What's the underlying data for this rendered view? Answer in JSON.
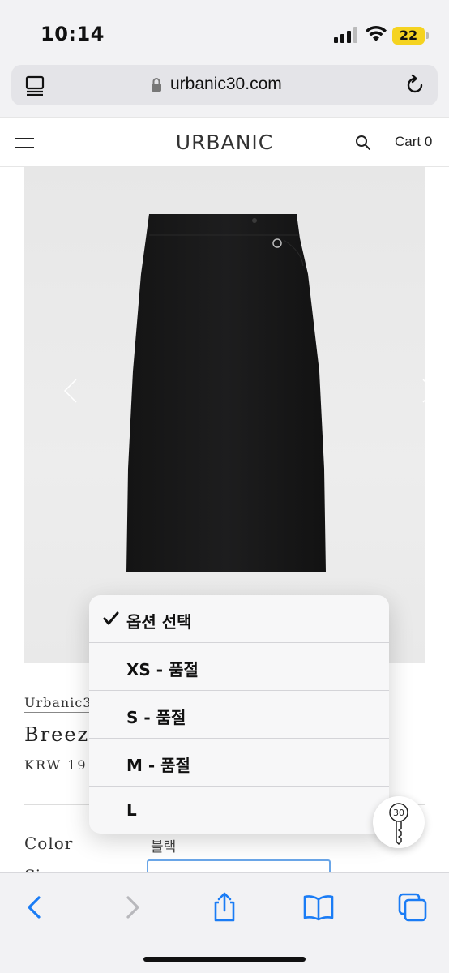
{
  "status_bar": {
    "time": "10:14",
    "battery": "22"
  },
  "browser": {
    "url": "urbanic30.com"
  },
  "site": {
    "brand": "URBANIC",
    "cart_label": "Cart 0"
  },
  "product": {
    "brand": "Urbanic3",
    "name": "Breezy",
    "price": "KRW 19",
    "color_label": "Color",
    "color_value": "블랙",
    "size_label": "Si",
    "size_select_value": "옵션 선택"
  },
  "size_dropdown": {
    "options": [
      {
        "label": "옵션 선택",
        "selected": true
      },
      {
        "label": "XS - 품절",
        "selected": false
      },
      {
        "label": "S - 품절",
        "selected": false
      },
      {
        "label": "M - 품절",
        "selected": false
      },
      {
        "label": "L",
        "selected": false
      }
    ]
  },
  "floating_badge": {
    "label": "30"
  },
  "colors": {
    "accent_blue": "#1a7cf5",
    "select_border": "#6aa6e8",
    "battery": "#f5d320"
  }
}
